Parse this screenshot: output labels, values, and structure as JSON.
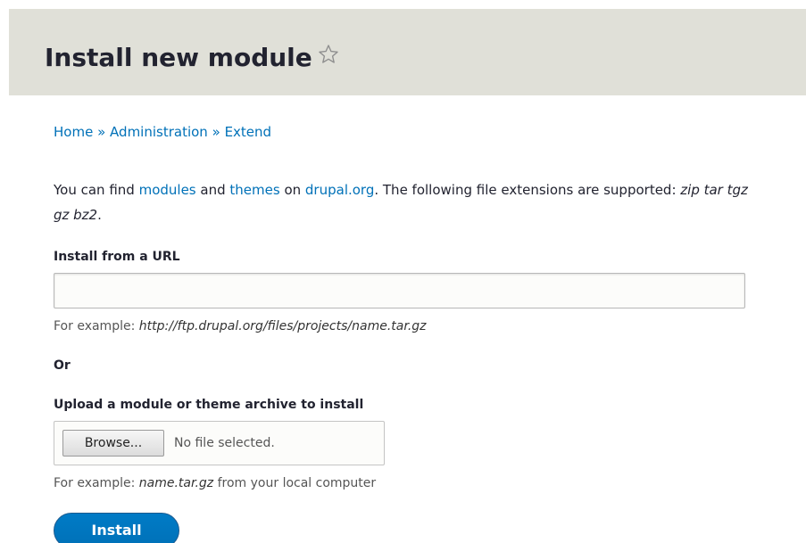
{
  "header": {
    "title": "Install new module"
  },
  "breadcrumb": {
    "items": [
      "Home",
      "Administration",
      "Extend"
    ],
    "separator": "»"
  },
  "intro": {
    "text_1": "You can find ",
    "link_modules": "modules",
    "text_2": " and ",
    "link_themes": "themes",
    "text_3": " on ",
    "link_drupal": "drupal.org",
    "text_4": ". The following file extensions are supported: ",
    "extensions": "zip tar tgz gz bz2",
    "text_5": "."
  },
  "url_field": {
    "label": "Install from a URL",
    "value": "",
    "description_prefix": "For example: ",
    "description_example": "http://ftp.drupal.org/files/projects/name.tar.gz"
  },
  "or_label": "Or",
  "upload_field": {
    "label": "Upload a module or theme archive to install",
    "browse_label": "Browse...",
    "status": "No file selected.",
    "description_prefix": "For example: ",
    "description_example": "name.tar.gz",
    "description_suffix": " from your local computer"
  },
  "install_button": {
    "label": "Install"
  },
  "colors": {
    "header_bg": "#e0e0d8",
    "link": "#0071b8",
    "button_primary": "#0071b8"
  }
}
